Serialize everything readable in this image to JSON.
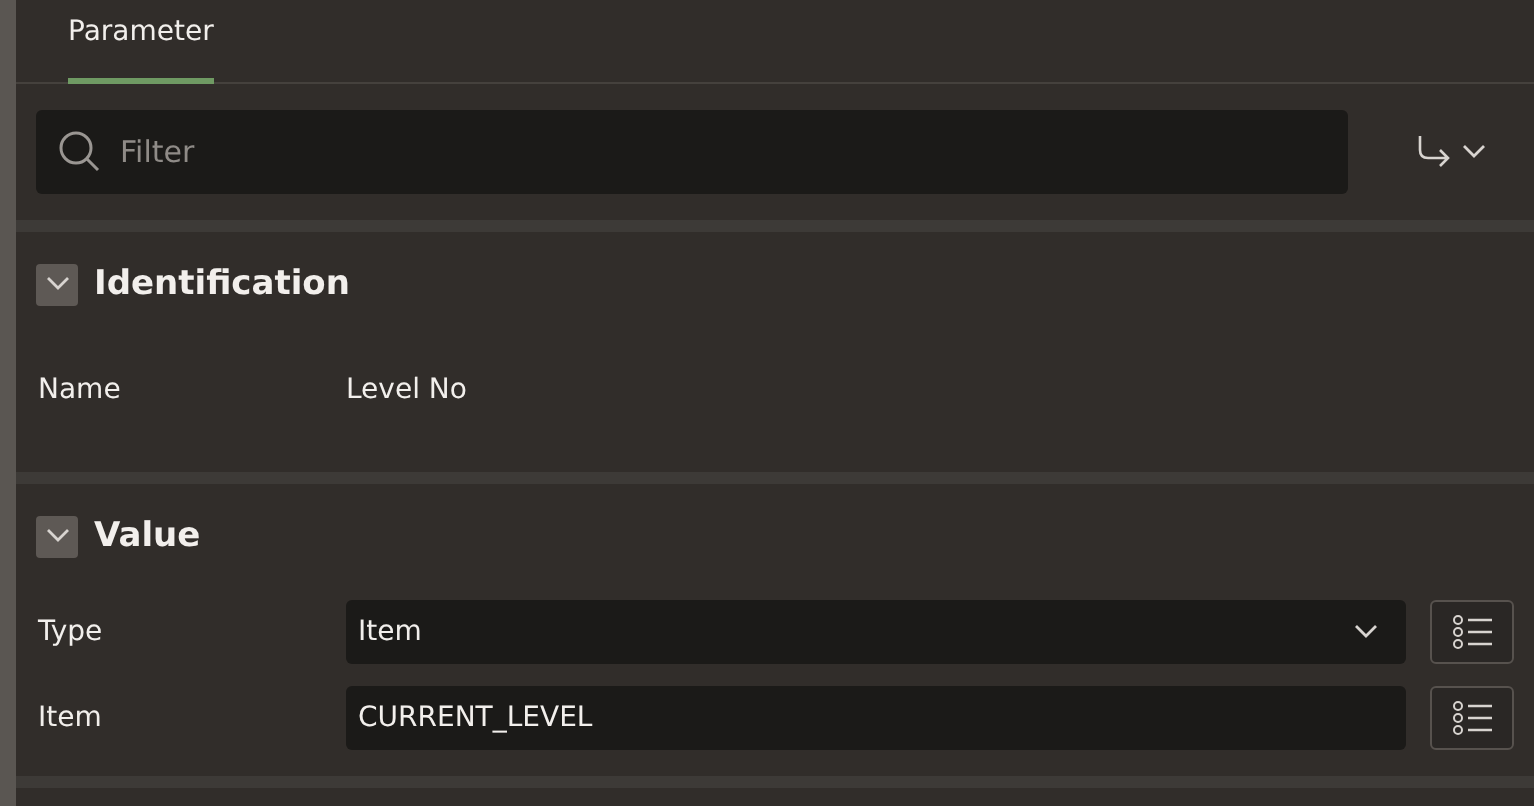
{
  "tabs": [
    {
      "label": "Parameter",
      "selected": true
    }
  ],
  "filter": {
    "placeholder": "Filter"
  },
  "sections": [
    {
      "title": "Identification",
      "expanded": true,
      "rows": [
        {
          "label": "Name",
          "kind": "static",
          "value": "Level No"
        }
      ]
    },
    {
      "title": "Value",
      "expanded": true,
      "rows": [
        {
          "label": "Type",
          "kind": "select",
          "value": "Item"
        },
        {
          "label": "Item",
          "kind": "text",
          "value": "CURRENT_LEVEL"
        }
      ]
    }
  ]
}
